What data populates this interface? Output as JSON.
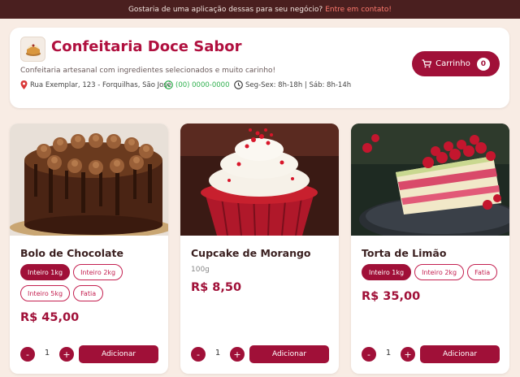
{
  "topbar": {
    "text": "Gostaria de uma aplicação dessas para seu negócio?",
    "link": "Entre em contato!"
  },
  "store": {
    "name": "Confeitaria Doce Sabor",
    "tagline": "Confeitaria artesanal com ingredientes selecionados e muito carinho!",
    "address": "Rua Exemplar, 123 - Forquilhas, São José",
    "phone": "(00) 0000-0000",
    "hours": "Seg-Sex: 8h-18h | Sáb: 8h-14h"
  },
  "cart": {
    "label": "Carrinho",
    "count": "0"
  },
  "colors": {
    "primary": "#a01038",
    "topbar": "#4a1f1f",
    "whatsapp": "#2fb04e",
    "background": "#f8ece4"
  },
  "products": [
    {
      "name": "Bolo de Chocolate",
      "options": [
        "Inteiro 1kg",
        "Inteiro 2kg",
        "Inteiro 5kg",
        "Fatia"
      ],
      "price": "R$ 45,00",
      "qty": "1",
      "add_label": "Adicionar",
      "qty_minus": "-",
      "qty_plus": "+"
    },
    {
      "name": "Cupcake de Morango",
      "weight": "100g",
      "price": "R$ 8,50",
      "qty": "1",
      "add_label": "Adicionar",
      "qty_minus": "-",
      "qty_plus": "+"
    },
    {
      "name": "Torta de Limão",
      "options": [
        "Inteiro 1kg",
        "Inteiro 2kg",
        "Fatia"
      ],
      "price": "R$ 35,00",
      "qty": "1",
      "add_label": "Adicionar",
      "qty_minus": "-",
      "qty_plus": "+"
    }
  ]
}
